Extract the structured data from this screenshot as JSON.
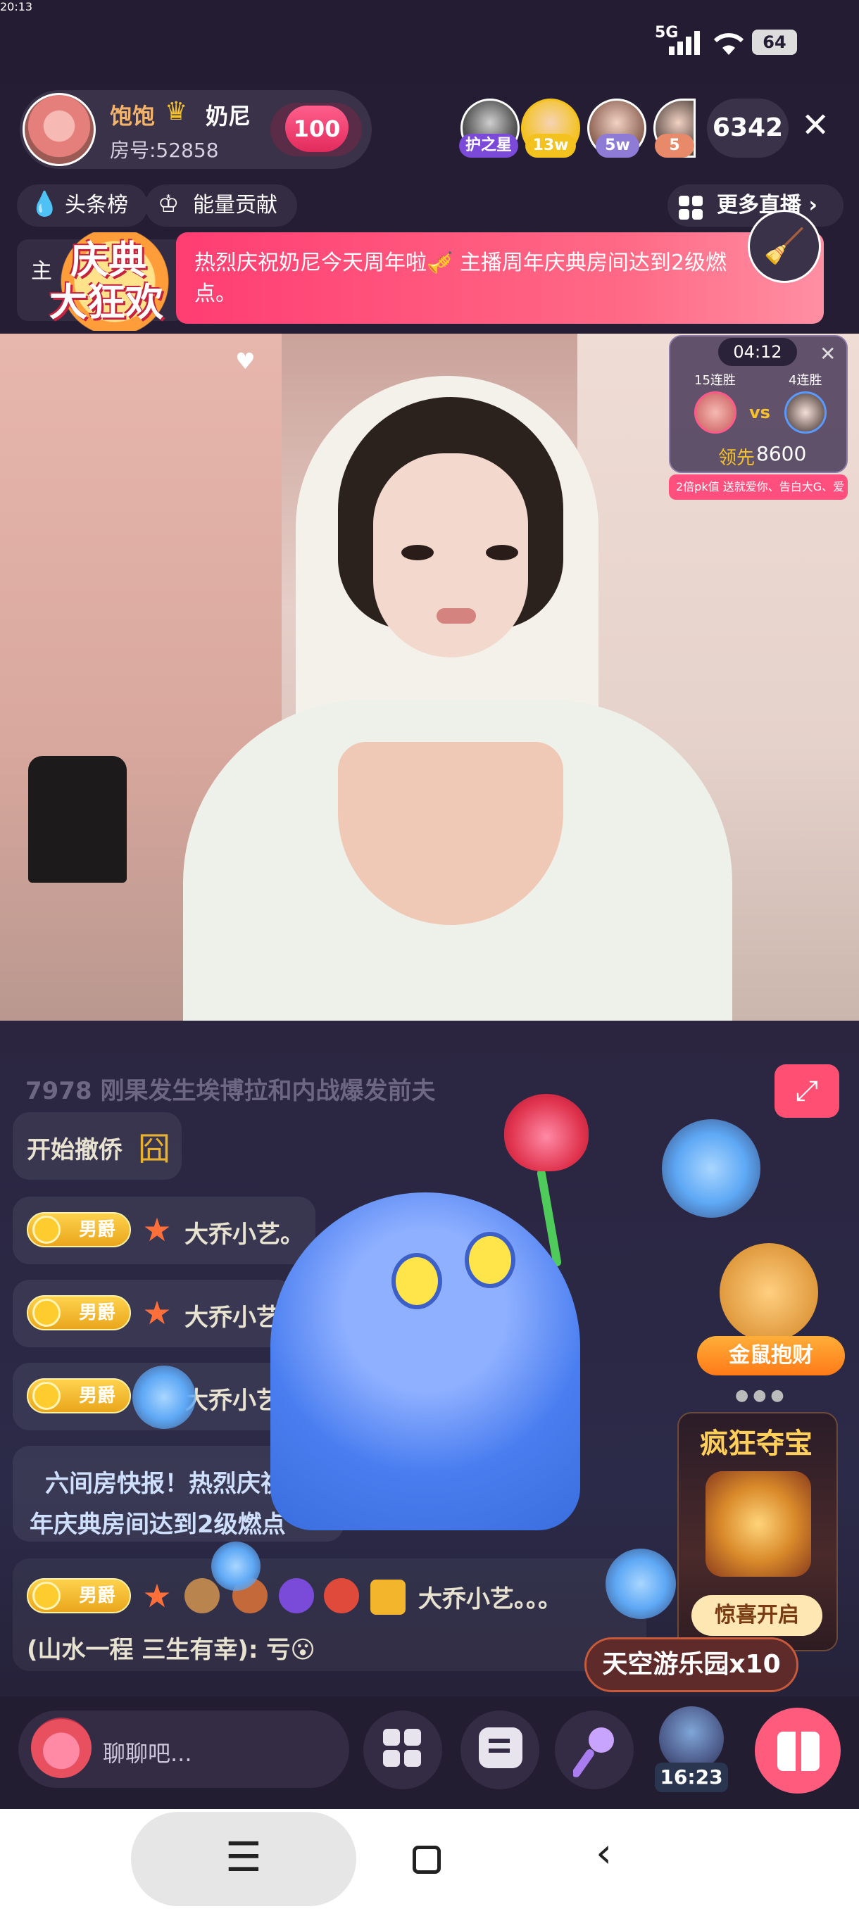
{
  "status_bar": {
    "time": "20:13",
    "network": "5G",
    "battery": "64"
  },
  "header": {
    "host_name": "饱饱",
    "host_name2": "奶尼",
    "room_label": "房号:52858",
    "fan_level": "100",
    "viewers": [
      {
        "tag": "护之星",
        "color": "#7c4ad8"
      },
      {
        "tag": "13w",
        "color": "#f3c21f"
      },
      {
        "tag": "5w",
        "color": "#8e7bd6"
      },
      {
        "tag": "5",
        "color": "#e88a6a"
      }
    ],
    "viewer_count": "6342",
    "close_icon": "close-icon"
  },
  "tabs": {
    "headlines": "头条榜",
    "energy": "能量贡献",
    "more_live": "更多直播"
  },
  "banner": {
    "festival_text_line1": "庆典",
    "festival_text_line2": "大狂欢",
    "side_char": "主",
    "message": "热烈庆祝奶尼今天周年啦🎺 主播周年庆典房间达到2级燃点。"
  },
  "pk": {
    "timer": "04:12",
    "left_streak": "15连胜",
    "right_streak": "4连胜",
    "vs": "vs",
    "lead_label": "领先",
    "lead_score": "8600",
    "ticker": "2倍pk值   送就爱你、告白大G、爱"
  },
  "chat": {
    "faint_top": "7978   刚果发生埃博拉和内战爆发前夫",
    "line1": "开始撤侨",
    "rows": [
      {
        "badge": "男爵",
        "level": "1",
        "name": "大乔小艺。"
      },
      {
        "badge": "男爵",
        "level": "1",
        "name": "大乔小艺"
      },
      {
        "badge": "男爵",
        "level": "1",
        "name": "大乔小艺。"
      }
    ],
    "room_news_line1": "六间房快报！热烈庆祝",
    "room_news_line2": "年庆典房间达到2级燃点",
    "last_row": {
      "badge": "男爵",
      "level": "1",
      "name": "大乔小艺。。。",
      "message": "(山水一程 三生有幸): 亏😮"
    }
  },
  "promos": {
    "rat_label": "金鼠抱财",
    "treasure_title": "疯狂夺宝",
    "treasure_button": "惊喜开启",
    "sky_park": "天空游乐园x10"
  },
  "bottom_bar": {
    "chat_placeholder": "聊聊吧...",
    "host_timer": "16:23"
  },
  "colors": {
    "background": "#241d34",
    "accent_pink": "#ff5b7d",
    "gold": "#f5c22c"
  }
}
